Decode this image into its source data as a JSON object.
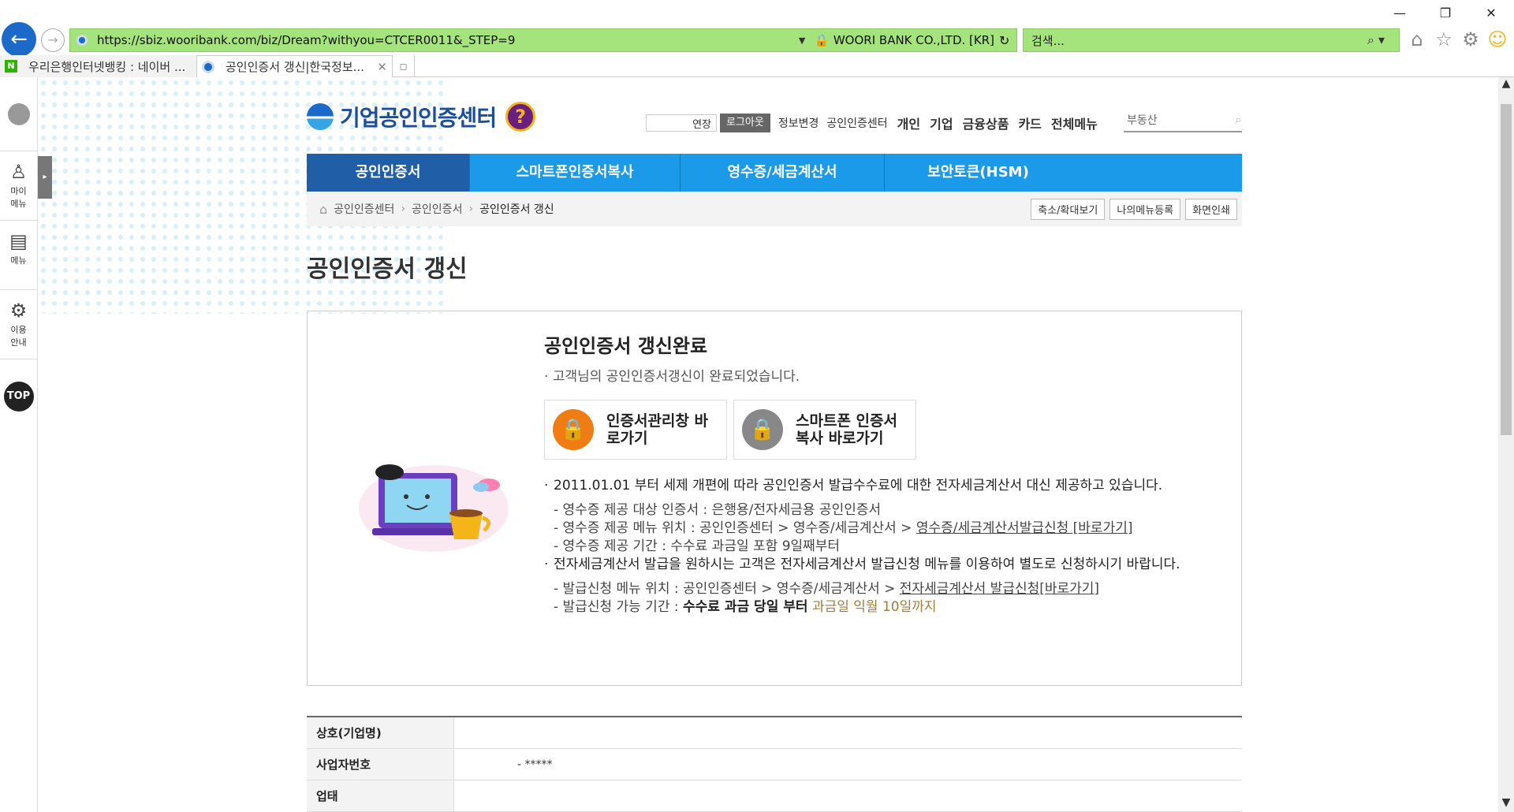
{
  "browser": {
    "url": "https://sbiz.wooribank.com/biz/Dream?withyou=CTCER0011&_STEP=9",
    "cert_label": "WOORI BANK CO.,LTD. [KR]",
    "search_placeholder": "검색...",
    "tabs": [
      {
        "title": "우리은행인터넷뱅킹 : 네이버 ..."
      },
      {
        "title": "공인인증서 갱신|한국정보..."
      }
    ]
  },
  "sidebar": {
    "items": [
      {
        "label": "마이\n메뉴",
        "icon": "person-icon"
      },
      {
        "label": "메뉴",
        "icon": "document-icon"
      },
      {
        "label": "이용\n안내",
        "icon": "gear-icon"
      }
    ],
    "top_label": "TOP"
  },
  "header": {
    "logo_text": "기업공인인증센터",
    "util": {
      "extend": "연장",
      "logout": "로그아웃",
      "info_change": "정보변경",
      "cert_center": "공인인증센터"
    },
    "gnb_links": [
      "개인",
      "기업",
      "금융상품",
      "카드",
      "전체메뉴"
    ],
    "search_placeholder": "부동산"
  },
  "gnb": [
    "공인인증서",
    "스마트폰인증서복사",
    "영수증/세금계산서",
    "보안토큰(HSM)"
  ],
  "breadcrumb": {
    "items": [
      "공인인증센터",
      "공인인증서",
      "공인인증서 갱신"
    ],
    "buttons": [
      "축소/확대보기",
      "나의메뉴등록",
      "화면인쇄"
    ]
  },
  "page_title": "공인인증서 갱신",
  "result": {
    "title": "공인인증서 갱신완료",
    "message": "고객님의 공인인증서갱신이 완료되었습니다.",
    "buttons": [
      {
        "label": "인증서관리창 바로가기",
        "color": "#f07d14"
      },
      {
        "label": "스마트폰 인증서 복사 바로가기",
        "color": "#888888"
      }
    ]
  },
  "notes": {
    "n1": "2011.01.01 부터 세제 개편에 따라 공인인증서 발급수수료에 대한 전자세금계산서 대신 제공하고 있습니다.",
    "n1_sub1": "- 영수증 제공 대상 인증서 : 은행용/전자세금용 공인인증서",
    "n1_sub2_prefix": "- 영수증 제공 메뉴 위치 : 공인인증센터 > 영수증/세금계산서 > ",
    "n1_sub2_link": "영수증/세금계산서발급신청 [바로가기]",
    "n1_sub3": "- 영수증 제공 기간 : 수수료 과금일 포함 9일째부터",
    "n2": "전자세금계산서 발급을 원하시는 고객은 전자세금계산서 발급신청 메뉴를 이용하여 별도로 신청하시기 바랍니다.",
    "n2_sub1_prefix": "- 발급신청 메뉴 위치 : 공인인증센터 > 영수증/세금계산서 > ",
    "n2_sub1_link": "전자세금계산서 발급신청[바로가기]",
    "n2_sub2_prefix": "- 발급신청 가능 기간 : ",
    "n2_sub2_strong": "수수료 과금 당일 부터",
    "n2_sub2_gold": "과금일 익월 10일까지"
  },
  "info_table": [
    {
      "label": "상호(기업명)",
      "value": ""
    },
    {
      "label": "사업자번호",
      "value": "- *****"
    },
    {
      "label": "업태",
      "value": ""
    }
  ]
}
